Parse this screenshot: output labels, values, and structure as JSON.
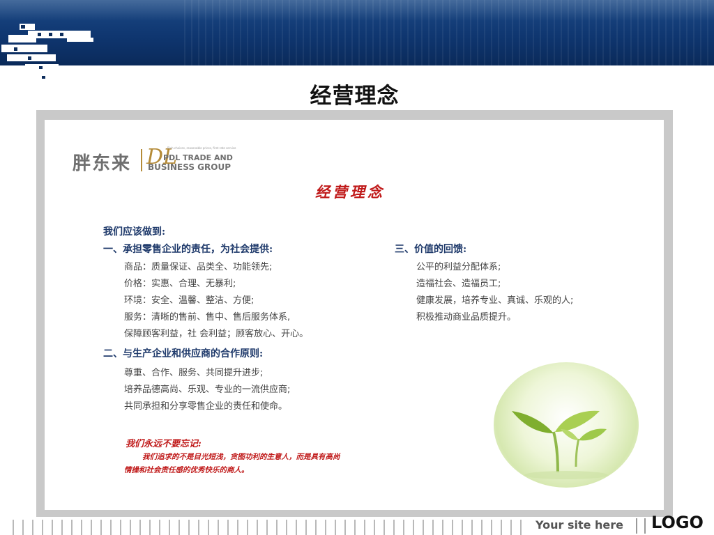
{
  "slide": {
    "title": "经营理念"
  },
  "brand": {
    "cn": "胖东来",
    "dl": "DL",
    "tagline": "Rich choices, reasonable prices, first-rate service",
    "en_line1": "PDL TRADE AND",
    "en_line2": "BUSINESS GROUP"
  },
  "panel": {
    "title": "经营理念",
    "intro": "我们应该做到:",
    "section1": {
      "heading": "一、承担零售企业的责任，为社会提供:",
      "items": [
        "商品：质量保证、品类全、功能领先;",
        "价格：实惠、合理、无暴利;",
        "环境：安全、温馨、整洁、方便;",
        "服务：清晰的售前、售中、售后服务体系,",
        "保障顾客利益，社  会利益；顾客放心、开心。"
      ]
    },
    "section2": {
      "heading": "二、与生产企业和供应商的合作原则:",
      "items": [
        "尊重、合作、服务、共同提升进步;",
        "培养品德高尚、乐观、专业的一流供应商;",
        "共同承担和分享零售企业的责任和使命。"
      ]
    },
    "section3": {
      "heading": "三、价值的回馈:",
      "items": [
        "公平的利益分配体系;",
        "造福社会、造福员工;",
        "健康发展，培养专业、真诚、乐观的人;",
        "积极推动商业品质提升。"
      ]
    },
    "remember": {
      "heading": "我们永远不要忘记:",
      "line1": "我们追求的不是目光短浅，贪图功利的生意人，而是具有高尚",
      "line2": "情操和社会责任感的优秀快乐的商人。"
    }
  },
  "footer": {
    "site": "Your site here",
    "logo": "LOGO"
  },
  "colors": {
    "header_blue": "#0f3670",
    "accent_red": "#c01a1a",
    "heading_navy": "#1f3a6b",
    "gold": "#b58b38"
  },
  "icons": [
    "pointing-hand-cursor-icon",
    "sprout-icon"
  ]
}
